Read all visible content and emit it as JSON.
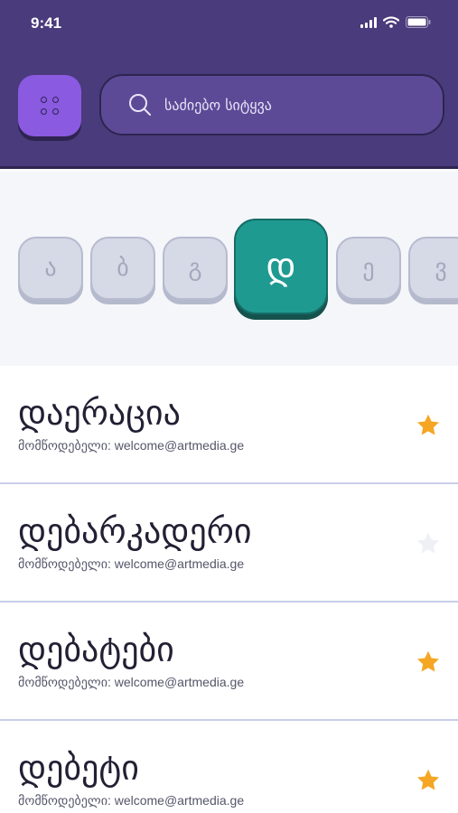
{
  "status_bar": {
    "time": "9:41"
  },
  "search": {
    "placeholder": "საძიებო სიტყვა"
  },
  "colors": {
    "accent": "#1f9a91",
    "header": "#4a3b7c",
    "menu_button": "#8a5ae0",
    "star_active": "#f5a623",
    "star_inactive": "#eef0f6"
  },
  "letters": [
    "ა",
    "ბ",
    "გ",
    "დ",
    "ე",
    "ვ"
  ],
  "active_letter": "დ",
  "words": [
    {
      "word": "დაერაცია",
      "author": "მომწოდებელი: welcome@artmedia.ge",
      "favorite": true
    },
    {
      "word": "დებარკადერი",
      "author": "მომწოდებელი: welcome@artmedia.ge",
      "favorite": false
    },
    {
      "word": "დებატები",
      "author": "მომწოდებელი: welcome@artmedia.ge",
      "favorite": true
    },
    {
      "word": "დებეტი",
      "author": "მომწოდებელი: welcome@artmedia.ge",
      "favorite": true
    }
  ]
}
